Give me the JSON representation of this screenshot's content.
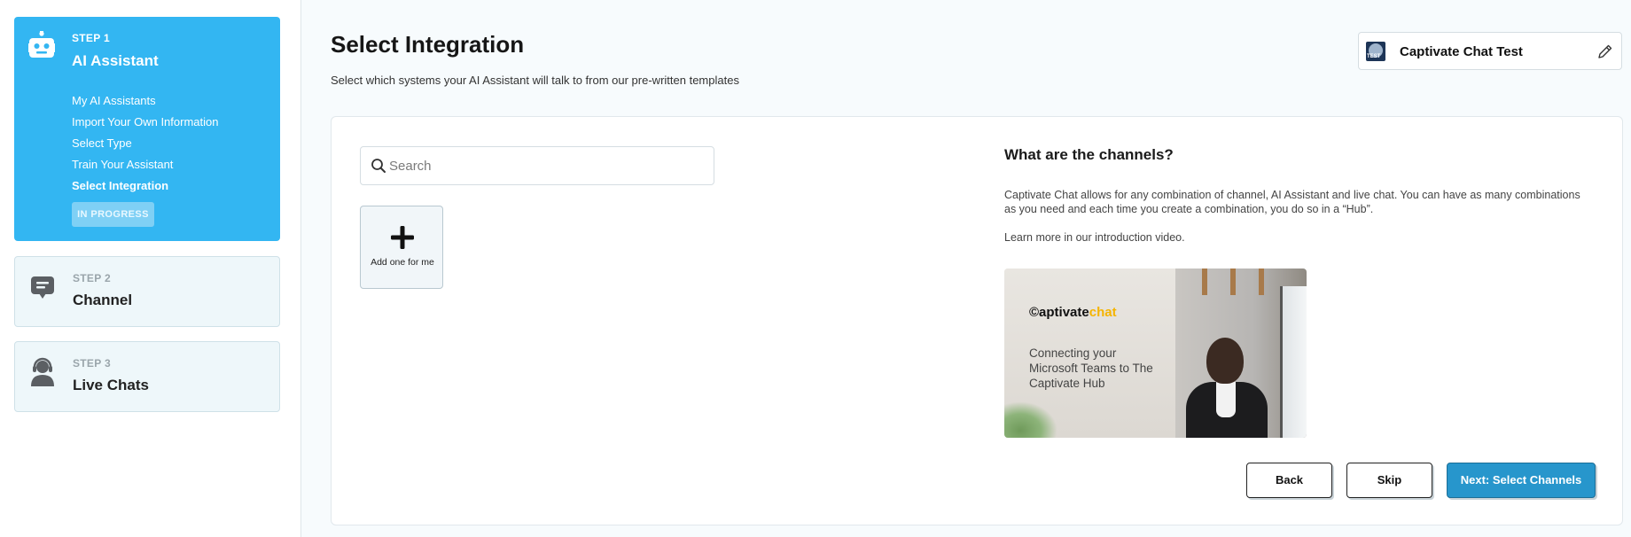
{
  "sidebar": {
    "steps": [
      {
        "number": "STEP 1",
        "title": "AI Assistant",
        "icon": "robot-icon",
        "substeps": [
          "My AI Assistants",
          "Import Your Own Information",
          "Select Type",
          "Train Your Assistant",
          "Select Integration"
        ],
        "current_substep": "Select Integration",
        "badge": "IN PROGRESS"
      },
      {
        "number": "STEP 2",
        "title": "Channel",
        "icon": "chat-bubble-icon"
      },
      {
        "number": "STEP 3",
        "title": "Live Chats",
        "icon": "support-agent-icon"
      }
    ]
  },
  "header": {
    "title": "Select Integration",
    "subtitle": "Select which systems your AI Assistant will talk to from our pre-written templates",
    "hub": {
      "logo_text": "TEST",
      "name": "Captivate Chat Test"
    }
  },
  "main": {
    "search": {
      "placeholder": "Search",
      "value": ""
    },
    "add_tile": {
      "label": "Add one for me"
    },
    "info": {
      "title": "What are the channels?",
      "body": "Captivate Chat allows for any combination of channel, AI Assistant and live chat. You can have as many combinations as you need and each time you create a combination, you do so in a “Hub”.",
      "learn_more": "Learn more in our introduction video."
    },
    "video": {
      "logo_prefix": "©aptivate",
      "logo_accent": "chat",
      "caption": "Connecting your Microsoft Teams to The Captivate Hub"
    },
    "buttons": {
      "back": "Back",
      "skip": "Skip",
      "next": "Next: Select Channels"
    }
  },
  "colors": {
    "active_step_bg": "#33b6f2",
    "inactive_step_bg": "#eef7fa",
    "primary_button": "#2796cc",
    "logo_accent": "#f5b400"
  }
}
